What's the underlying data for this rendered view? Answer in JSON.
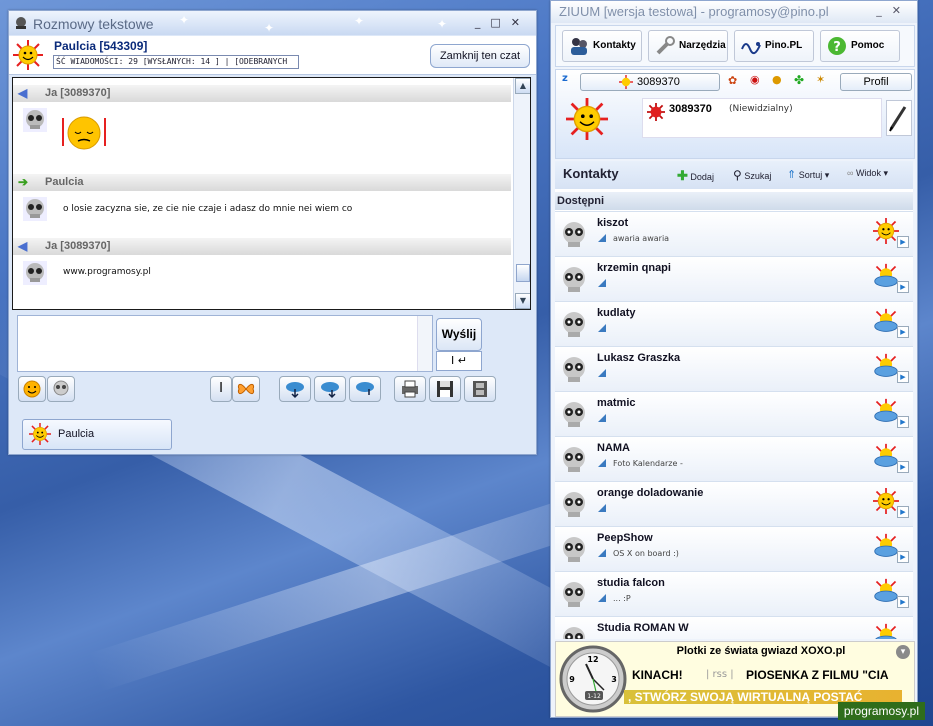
{
  "chat_window": {
    "title": "Rozmowy tekstowe",
    "minimize": "_",
    "maximize": "□",
    "close": "✕",
    "partner_title": "Paulcia [543309]",
    "stats": "ŚĆ WIADOMOŚCI: 29 [WYSŁANYCH: 14 ] | [ODEBRANYCH",
    "close_chat_label": "Zamknij ten czat",
    "messages": [
      {
        "author": "Ja [3089370]",
        "direction": "out",
        "text": "",
        "has_emoticon": true
      },
      {
        "author": "Paulcia",
        "direction": "in",
        "text": "o losie zacyzna sie, ze cie nie czaje i adasz do mnie nei wiem co"
      },
      {
        "author": "Ja [3089370]",
        "direction": "out",
        "text": "www.programosy.pl"
      }
    ],
    "input_value": "",
    "send_label": "Wyślij",
    "enter_label": "I ↵",
    "toolbar_sep_label": "I",
    "active_contact_tab": "Paulcia"
  },
  "ziuum": {
    "title": "ZIUUM [wersja testowa] - programosy@pino.pl",
    "menu": [
      {
        "label": "Kontakty",
        "icon": "contacts-icon"
      },
      {
        "label": "Narzędzia",
        "icon": "tools-icon"
      },
      {
        "label": "Pino.PL",
        "icon": "pino-logo-icon"
      },
      {
        "label": "Pomoc",
        "icon": "help-icon"
      }
    ],
    "status_number": "3089370",
    "profile_label": "Profil",
    "user_number": "3089370",
    "user_status": "(Niewidzialny)",
    "contacts_heading": "Kontakty",
    "actions": {
      "add": "Dodaj",
      "search": "Szukaj",
      "sort": "Sortuj",
      "view": "Widok"
    },
    "group_name": "Dostępni",
    "contacts": [
      {
        "name": "kiszot",
        "desc": "awaria awaria",
        "status": "sun"
      },
      {
        "name": "krzemin qnapi",
        "desc": "",
        "status": "cloud"
      },
      {
        "name": "kudlaty",
        "desc": "",
        "status": "cloud"
      },
      {
        "name": "Lukasz Graszka",
        "desc": "",
        "status": "cloud"
      },
      {
        "name": "matmic",
        "desc": "",
        "status": "cloud"
      },
      {
        "name": "NAMA",
        "desc": "Foto Kalendarze  -",
        "status": "cloud"
      },
      {
        "name": "orange doladowanie",
        "desc": "",
        "status": "sun"
      },
      {
        "name": "PeepShow",
        "desc": "OS X on board :)",
        "status": "cloud"
      },
      {
        "name": "studia falcon",
        "desc": "... :P",
        "status": "cloud"
      },
      {
        "name": "Studia ROMAN W",
        "desc": "",
        "status": "cloud"
      }
    ],
    "news": {
      "title": "Plotki ze świata gwiazd XOXO.pl",
      "line1a": "KINACH!",
      "rss": "| rss |",
      "line1b": "PIOSENKA Z FILMU \"CIA",
      "line2": ", STWÓRZ SWOJĄ WIRTUALNĄ POSTAĆ",
      "clock_badge": "1-12"
    }
  },
  "watermark": "programosy.pl",
  "colors": {
    "accent": "#0a2a7a",
    "sun": "#ffcc00",
    "sun_rays": "#e62020"
  }
}
